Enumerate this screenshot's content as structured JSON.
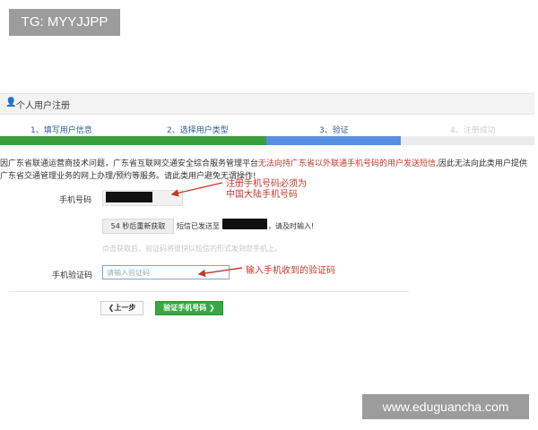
{
  "watermark_tag": "TG: MYYJJPP",
  "header": {
    "title": "个人用户注册",
    "icon": "user-icon"
  },
  "steps": [
    {
      "label": "1、填写用户信息",
      "state": "done"
    },
    {
      "label": "2、选择用户类型",
      "state": "done"
    },
    {
      "label": "3、验证",
      "state": "current"
    },
    {
      "label": "4、注册成功",
      "state": "pending"
    }
  ],
  "notice": {
    "part1": "因广东省联通运营商技术问题，广东省互联网交通安全综合服务管理平台",
    "red": "无法向持广东省以外联通手机号码的用户发送短信",
    "part2": ",因此无法向此类用户提供广东省交通管理业务的网上办理/预约等服务。请此类用户避免无谓操作!"
  },
  "phone": {
    "label": "手机号码"
  },
  "annotations": {
    "phone_line1": "注册手机号码必须为",
    "phone_line2": "中国大陆手机号码",
    "code": "输入手机收到的验证码"
  },
  "sms": {
    "resend_label": "54 秒后重新获取",
    "sent_prefix": "短信已发送至",
    "sent_suffix": "，请及时输入!",
    "hint": "点击获取后，验证码将很快以短信的形式发到您手机上。"
  },
  "code": {
    "label": "手机验证码",
    "placeholder": "请输入验证码"
  },
  "buttons": {
    "prev": "上一步",
    "verify": "验证手机号码"
  },
  "site_watermark": "www.eduguancha.com",
  "colors": {
    "progress_done": "#3c9f3f",
    "progress_current": "#5a8fe0",
    "accent_red": "#c0392b",
    "verify_button": "#38a843"
  }
}
